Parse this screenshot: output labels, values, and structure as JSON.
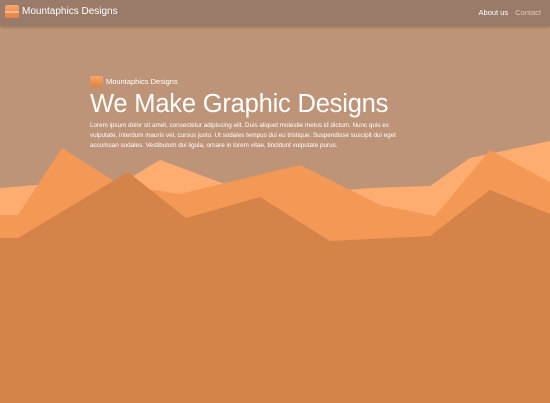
{
  "navbar": {
    "brand": "Mountaphics Designs",
    "links": [
      {
        "label": "About us",
        "active": true
      },
      {
        "label": "Contact",
        "active": false
      }
    ]
  },
  "hero": {
    "brand": "Mountaphics Designs",
    "title": "We Make Graphic Designs",
    "body": "Lorem ipsum dolor sit amet, consectetur adipiscing elit. Duis aliquet molestie metus id dictum. Nunc quis ex vulputate, interdum mauris vel, cursus justo. Ut sodales tempus dui eu tristique. Suspendisse suscipit dui eget accumsan sodales. Vestibulum dui ligula, ornare in lorem vitae, tincidunt vulputate purus."
  },
  "colors": {
    "navbar": "#9a7b69",
    "sky": "#be9478",
    "mountain_far": "#ffac70",
    "mountain_mid": "#f49856",
    "mountain_near": "#d6834a"
  },
  "icons": [
    "mountain-logo-icon"
  ]
}
